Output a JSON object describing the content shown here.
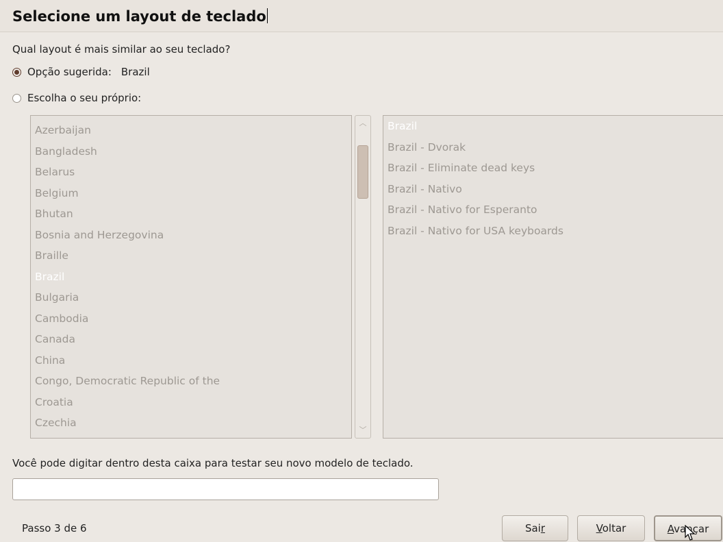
{
  "header": {
    "title": "Selecione um layout de teclado"
  },
  "question": "Qual layout é mais similar ao seu teclado?",
  "options": {
    "suggested_label": "Opção sugerida:",
    "suggested_value": "Brazil",
    "own_label": "Escolha o seu próprio:"
  },
  "countries": [
    "Azerbaijan",
    "Bangladesh",
    "Belarus",
    "Belgium",
    "Bhutan",
    "Bosnia and Herzegovina",
    "Braille",
    "Brazil",
    "Bulgaria",
    "Cambodia",
    "Canada",
    "China",
    "Congo, Democratic Republic of the",
    "Croatia",
    "Czechia"
  ],
  "selected_country": "Brazil",
  "variants": [
    "Brazil",
    "Brazil - Dvorak",
    "Brazil - Eliminate dead keys",
    "Brazil - Nativo",
    "Brazil - Nativo for Esperanto",
    "Brazil - Nativo for USA keyboards"
  ],
  "selected_variant": "Brazil",
  "test_hint": "Você pode digitar dentro desta caixa para testar seu novo modelo de teclado.",
  "test_input_value": "",
  "footer": {
    "step": "Passo 3 de 6",
    "quit": {
      "pre": "Sai",
      "key": "r",
      "post": ""
    },
    "back": {
      "pre": "",
      "key": "V",
      "post": "oltar"
    },
    "next": {
      "pre": "",
      "key": "A",
      "post": "vançar"
    }
  }
}
